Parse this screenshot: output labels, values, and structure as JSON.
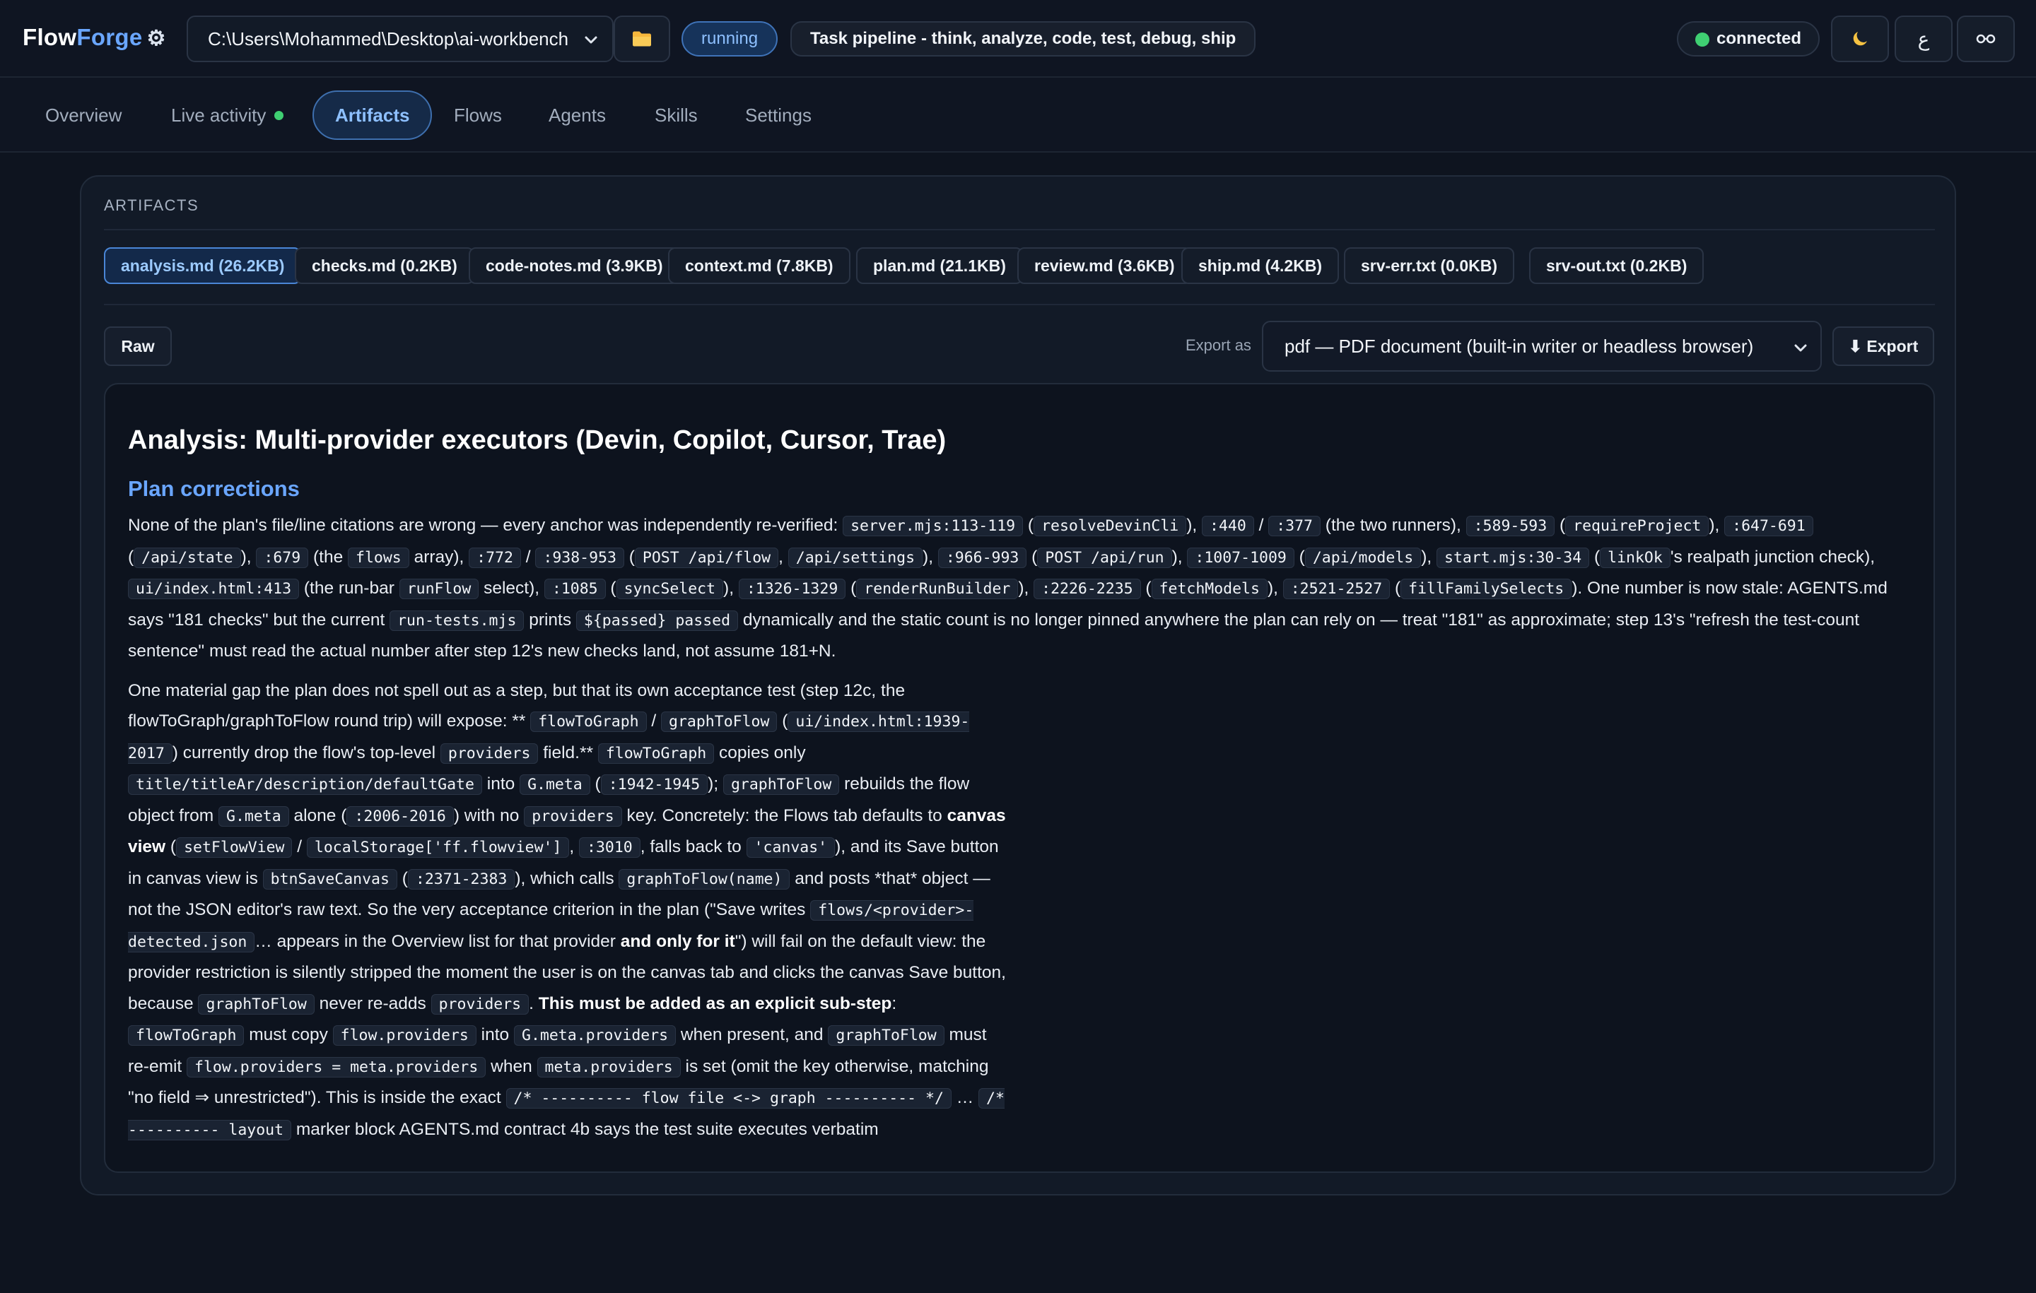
{
  "app": {
    "name_a": "Flow",
    "name_b": "Forge"
  },
  "header": {
    "path": "C:\\Users\\Mohammed\\Desktop\\ai-workbench",
    "status": "running",
    "task": "Task pipeline - think, analyze, code, test, debug, ship",
    "connection": "connected",
    "lang_toggle": "ع"
  },
  "tabs": [
    {
      "label": "Overview"
    },
    {
      "label": "Live activity"
    },
    {
      "label": "Artifacts"
    },
    {
      "label": "Flows"
    },
    {
      "label": "Agents"
    },
    {
      "label": "Skills"
    },
    {
      "label": "Settings"
    }
  ],
  "panel": {
    "title": "ARTIFACTS"
  },
  "artifacts": [
    {
      "label": "analysis.md (26.2KB)"
    },
    {
      "label": "checks.md (0.2KB)"
    },
    {
      "label": "code-notes.md (3.9KB)"
    },
    {
      "label": "context.md (7.8KB)"
    },
    {
      "label": "plan.md (21.1KB)"
    },
    {
      "label": "review.md (3.6KB)"
    },
    {
      "label": "ship.md (4.2KB)"
    },
    {
      "label": "srv-err.txt (0.0KB)"
    },
    {
      "label": "srv-out.txt (0.2KB)"
    }
  ],
  "toolbar": {
    "raw_label": "Raw",
    "export_as_label": "Export as",
    "export_format": "pdf — PDF document (built-in writer or headless browser)",
    "export_button": "⬇ Export"
  },
  "document": {
    "title": "Analysis: Multi-provider executors (Devin, Copilot, Cursor, Trae)",
    "section": "Plan corrections",
    "p1": [
      {
        "t": "None of the plan's file/line citations are wrong — every anchor was independently re-verified: "
      },
      {
        "c": "server.mjs:113-119"
      },
      {
        "t": " ("
      },
      {
        "c": "resolveDevinCli"
      },
      {
        "t": "), "
      },
      {
        "c": ":440"
      },
      {
        "t": " / "
      },
      {
        "c": ":377"
      },
      {
        "t": " (the two runners), "
      },
      {
        "c": ":589-593"
      },
      {
        "t": " ("
      },
      {
        "c": "requireProject"
      },
      {
        "t": "), "
      },
      {
        "c": ":647-691"
      },
      {
        "t": " ("
      },
      {
        "c": "/api/state"
      },
      {
        "t": "), "
      },
      {
        "c": ":679"
      },
      {
        "t": " (the "
      },
      {
        "c": "flows"
      },
      {
        "t": " array), "
      },
      {
        "c": ":772"
      },
      {
        "t": " / "
      },
      {
        "c": ":938-953"
      },
      {
        "t": " ("
      },
      {
        "c": "POST /api/flow"
      },
      {
        "t": ", "
      },
      {
        "c": "/api/settings"
      },
      {
        "t": "), "
      },
      {
        "c": ":966-993"
      },
      {
        "t": " ("
      },
      {
        "c": "POST /api/run"
      },
      {
        "t": "), "
      },
      {
        "c": ":1007-1009"
      },
      {
        "t": " ("
      },
      {
        "c": "/api/models"
      },
      {
        "t": "), "
      },
      {
        "c": "start.mjs:30-34"
      },
      {
        "t": " ("
      },
      {
        "c": "linkOk"
      },
      {
        "t": "'s realpath junction check), "
      },
      {
        "c": "ui/index.html:413"
      },
      {
        "t": " (the run-bar "
      },
      {
        "c": "runFlow"
      },
      {
        "t": " select), "
      },
      {
        "c": ":1085"
      },
      {
        "t": " ("
      },
      {
        "c": "syncSelect"
      },
      {
        "t": "), "
      },
      {
        "c": ":1326-1329"
      },
      {
        "t": " ("
      },
      {
        "c": "renderRunBuilder"
      },
      {
        "t": "), "
      },
      {
        "c": ":2226-2235"
      },
      {
        "t": " ("
      },
      {
        "c": "fetchModels"
      },
      {
        "t": "), "
      },
      {
        "c": ":2521-2527"
      },
      {
        "t": " ("
      },
      {
        "c": "fillFamilySelects"
      },
      {
        "t": "). One number is now stale: AGENTS.md says \"181 checks\" but the current "
      },
      {
        "c": "run-tests.mjs"
      },
      {
        "t": " prints "
      },
      {
        "c": "${passed} passed"
      },
      {
        "t": " dynamically and the static count is no longer pinned anywhere the plan can rely on — treat \"181\" as approximate; step 13's \"refresh the test-count sentence\" must read the actual number after step 12's new checks land, not assume 181+N."
      }
    ],
    "p2": [
      {
        "t": "One material gap the plan does not spell out as a step, but that its own acceptance test (step 12c, the flowToGraph/graphToFlow round trip) will expose: ** "
      },
      {
        "c": "flowToGraph"
      },
      {
        "t": " / "
      },
      {
        "c": "graphToFlow"
      },
      {
        "t": " ("
      },
      {
        "c": "ui/index.html:1939-2017"
      },
      {
        "t": ") currently drop the flow's top-level "
      },
      {
        "c": "providers"
      },
      {
        "t": " field.** "
      },
      {
        "c": "flowToGraph"
      },
      {
        "t": " copies only "
      },
      {
        "c": "title/titleAr/description/defaultGate"
      },
      {
        "t": " into "
      },
      {
        "c": "G.meta"
      },
      {
        "t": " ("
      },
      {
        "c": ":1942-1945"
      },
      {
        "t": "); "
      },
      {
        "c": "graphToFlow"
      },
      {
        "t": " rebuilds the flow object from "
      },
      {
        "c": "G.meta"
      },
      {
        "t": " alone ("
      },
      {
        "c": ":2006-2016"
      },
      {
        "t": ") with no "
      },
      {
        "c": "providers"
      },
      {
        "t": " key. Concretely: the Flows tab defaults to "
      },
      {
        "b": "canvas view"
      },
      {
        "t": " ("
      },
      {
        "c": "setFlowView"
      },
      {
        "t": " / "
      },
      {
        "c": "localStorage['ff.flowview']"
      },
      {
        "t": ", "
      },
      {
        "c": ":3010"
      },
      {
        "t": ", falls back to "
      },
      {
        "c": "'canvas'"
      },
      {
        "t": "), and its Save button in canvas view is "
      },
      {
        "c": "btnSaveCanvas"
      },
      {
        "t": " ("
      },
      {
        "c": ":2371-2383"
      },
      {
        "t": "), which calls "
      },
      {
        "c": "graphToFlow(name)"
      },
      {
        "t": " and posts *that* object — not the JSON editor's raw text. So the very acceptance criterion in the plan (\"Save writes "
      },
      {
        "c": "flows/<provider>-detected.json"
      },
      {
        "t": "… appears in the Overview list for that provider "
      },
      {
        "b": "and only for it"
      },
      {
        "t": "\") will fail on the default view: the provider restriction is silently stripped the moment the user is on the canvas tab and clicks the canvas Save button, because "
      },
      {
        "c": "graphToFlow"
      },
      {
        "t": " never re-adds "
      },
      {
        "c": "providers"
      },
      {
        "t": ". "
      },
      {
        "b": "This must be added as an explicit sub-step"
      },
      {
        "t": ": "
      },
      {
        "c": "flowToGraph"
      },
      {
        "t": " must copy "
      },
      {
        "c": "flow.providers"
      },
      {
        "t": " into "
      },
      {
        "c": "G.meta.providers"
      },
      {
        "t": " when present, and "
      },
      {
        "c": "graphToFlow"
      },
      {
        "t": " must re-emit "
      },
      {
        "c": "flow.providers = meta.providers"
      },
      {
        "t": " when "
      },
      {
        "c": "meta.providers"
      },
      {
        "t": " is set (omit the key otherwise, matching \"no field ⇒ unrestricted\"). This is inside the exact "
      },
      {
        "c": "/* ---------- flow file <-> graph ---------- */"
      },
      {
        "t": " … "
      },
      {
        "c": "/* ---------- layout"
      },
      {
        "t": " marker block AGENTS.md contract 4b says the test suite executes verbatim"
      }
    ]
  }
}
